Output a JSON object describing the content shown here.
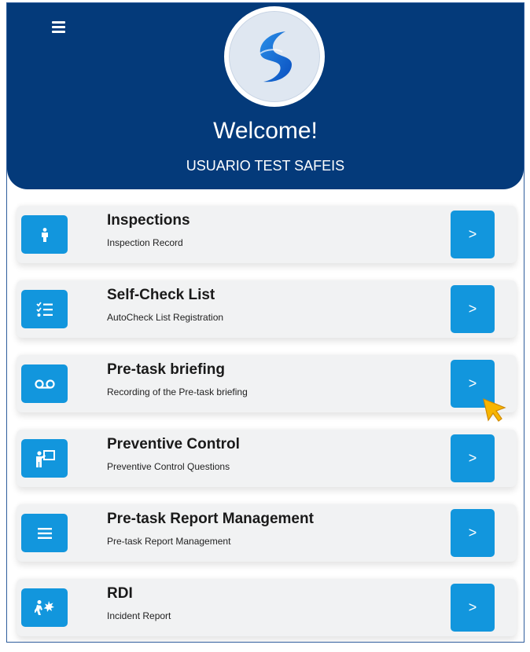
{
  "header": {
    "welcome": "Welcome!",
    "username": "USUARIO TEST SAFEIS",
    "menu_icon": "hamburger-menu-icon",
    "logo": "app-logo",
    "background_color": "#043a7a"
  },
  "menu": {
    "accent_color": "#1296dd",
    "items": [
      {
        "title": "Inspections",
        "subtitle": "Inspection Record",
        "icon": "person-icon",
        "action": ">"
      },
      {
        "title": "Self-Check List",
        "subtitle": "AutoCheck List Registration",
        "icon": "checklist-icon",
        "action": ">"
      },
      {
        "title": "Pre-task briefing",
        "subtitle": "Recording of the Pre-task briefing",
        "icon": "voicemail-icon",
        "action": ">"
      },
      {
        "title": "Preventive Control",
        "subtitle": "Preventive Control Questions",
        "icon": "presenter-icon",
        "action": ">"
      },
      {
        "title": "Pre-task Report Management",
        "subtitle": "Pre-task Report Management",
        "icon": "list-icon",
        "action": ">"
      },
      {
        "title": "RDI",
        "subtitle": "Incident Report",
        "icon": "incident-icon",
        "action": ">"
      }
    ]
  }
}
